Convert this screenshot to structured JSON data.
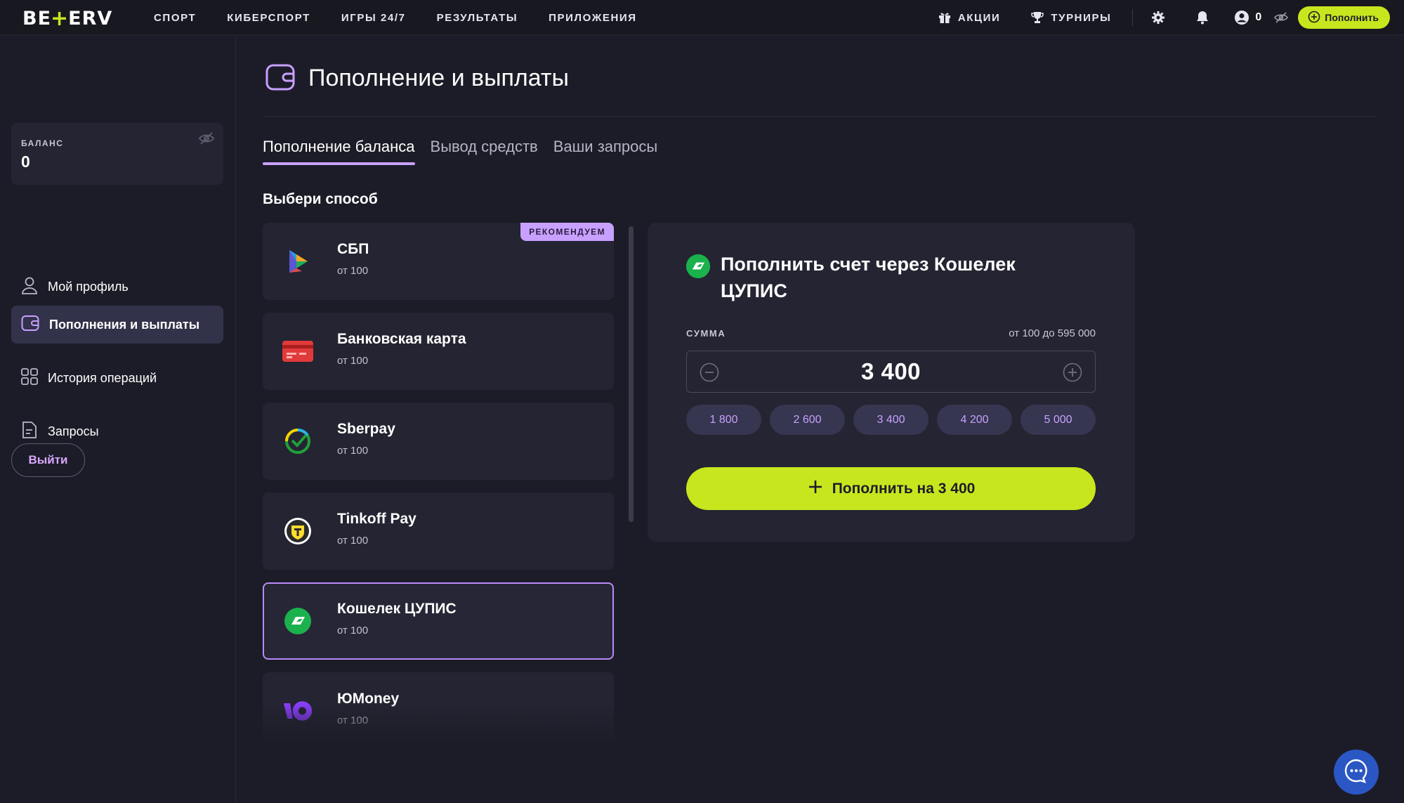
{
  "brand": {
    "logo_left": "BE",
    "logo_plus": "+",
    "logo_right": "ERV",
    "accent": "#c8e61e",
    "purple": "#c8a0ff"
  },
  "nav": {
    "links": [
      "СПОРТ",
      "КИБЕРСПОРТ",
      "ИГРЫ 24/7",
      "РЕЗУЛЬТАТЫ",
      "ПРИЛОЖЕНИЯ"
    ],
    "promo_label": "АКЦИИ",
    "tournaments_label": "ТУРНИРЫ",
    "balance": "0",
    "topup_label": "Пополнить"
  },
  "sidebar": {
    "balance_label": "БАЛАНС",
    "balance_value": "0",
    "items": [
      {
        "label": "Мой профиль",
        "icon": "user-icon"
      },
      {
        "label": "Пополнения и выплаты",
        "icon": "wallet-icon",
        "active": true
      },
      {
        "label": "История операций",
        "icon": "grid-icon"
      },
      {
        "label": "Запросы",
        "icon": "document-icon"
      }
    ],
    "logout_label": "Выйти"
  },
  "page": {
    "title": "Пополнение и выплаты",
    "tabs": [
      {
        "label": "Пополнение баланса",
        "active": true
      },
      {
        "label": "Вывод средств"
      },
      {
        "label": "Ваши запросы"
      }
    ],
    "section_title": "Выбери способ"
  },
  "methods": [
    {
      "name": "СБП",
      "min": "от 100",
      "badge": "РЕКОМЕНДУЕМ",
      "icon": "sbp-icon"
    },
    {
      "name": "Банковская карта",
      "min": "от 100",
      "icon": "bank-card-icon"
    },
    {
      "name": "Sberpay",
      "min": "от 100",
      "icon": "sberpay-icon"
    },
    {
      "name": "Tinkoff Pay",
      "min": "от 100",
      "icon": "tinkoff-icon"
    },
    {
      "name": "Кошелек ЦУПИС",
      "min": "от 100",
      "icon": "cupis-icon",
      "selected": true
    },
    {
      "name": "ЮMoney",
      "min": "от 100",
      "icon": "yoomoney-icon"
    }
  ],
  "payment": {
    "title": "Пополнить счет через Кошелек ЦУПИС",
    "sum_label": "СУММА",
    "range": "от 100 до 595 000",
    "amount": "3 400",
    "chips": [
      "1 800",
      "2 600",
      "3 400",
      "4 200",
      "5 000"
    ],
    "button_label": "Пополнить на 3 400"
  }
}
